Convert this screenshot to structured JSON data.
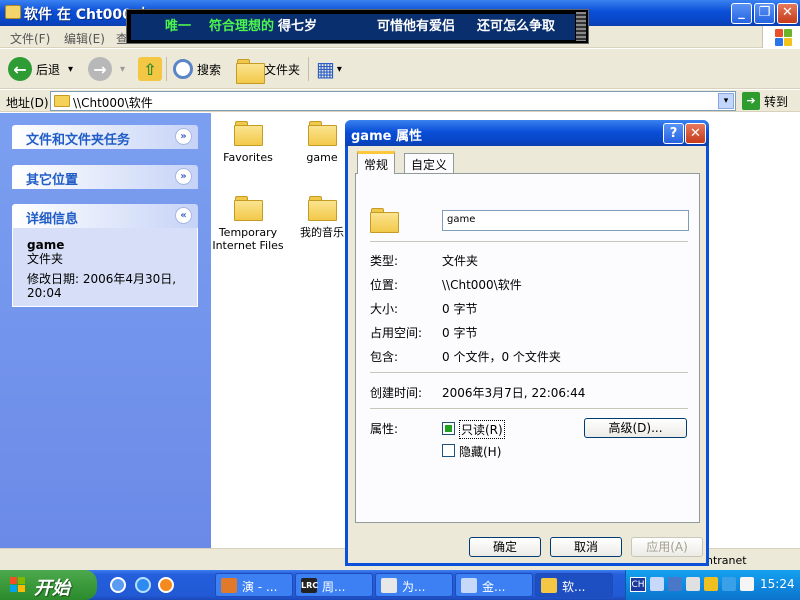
{
  "window": {
    "title": "软件 在 Cht000 上",
    "minimize": "_",
    "maximize": "❐",
    "close": "✕"
  },
  "lyrics": {
    "line1_a": "唯一",
    "line1_b": "符合理想的",
    "line1_c": "得七岁",
    "line2": "可惜他有爱侣",
    "line3": "还可怎么争取"
  },
  "menu": [
    "文件(F)",
    "编辑(E)",
    "查"
  ],
  "toolbar": {
    "back_label": "后退",
    "back_glyph": "←",
    "forward_glyph": "→",
    "dropdown_glyph": "▾",
    "up_glyph": "⇧",
    "search_label": "搜索",
    "folders_label": "文件夹",
    "views_glyph": "▦"
  },
  "address": {
    "label": "地址(D)",
    "value": "\\\\Cht000\\软件",
    "dropdown_glyph": "▾",
    "go_label": "转到",
    "go_glyph": "➔"
  },
  "taskpane": {
    "file_tasks_title": "文件和文件夹任务",
    "other_places_title": "其它位置",
    "details_title": "详细信息",
    "expand_glyph": "»",
    "collapse_glyph": "«",
    "details_name": "game",
    "details_type": "文件夹",
    "details_modified": "修改日期: 2006年4月30日,",
    "details_time": "20:04"
  },
  "files": [
    {
      "name": "Favorites"
    },
    {
      "name": "game"
    },
    {
      "name": "Temporary Internet Files"
    },
    {
      "name": "我的音乐"
    }
  ],
  "statusbar": {
    "zone": "ntranet"
  },
  "dialog": {
    "title": "game 属性",
    "help_glyph": "?",
    "close_glyph": "✕",
    "tabs": [
      "常规",
      "自定义"
    ],
    "name_value": "game",
    "type_label": "类型:",
    "type_value": "文件夹",
    "location_label": "位置:",
    "location_value": "\\\\Cht000\\软件",
    "size_label": "大小:",
    "size_value": "0 字节",
    "size_on_disk_label": "占用空间:",
    "size_on_disk_value": "0 字节",
    "contains_label": "包含:",
    "contains_value": "0 个文件，0 个文件夹",
    "created_label": "创建时间:",
    "created_value": "2006年3月7日, 22:06:44",
    "attributes_label": "属性:",
    "readonly_label": "只读(R)",
    "readonly_checked": true,
    "hidden_label": "隐藏(H)",
    "hidden_checked": false,
    "advanced_label": "高级(D)...",
    "ok_label": "确定",
    "cancel_label": "取消",
    "apply_label": "应用(A)"
  },
  "taskbar": {
    "start_label": "开始",
    "tasks": [
      {
        "label": "演 - ...",
        "icon": "music-icon",
        "badge": ""
      },
      {
        "label": "周...",
        "icon": "lrc-icon",
        "badge": "LRC"
      },
      {
        "label": "为...",
        "icon": "document-icon",
        "badge": ""
      },
      {
        "label": "金...",
        "icon": "window-icon",
        "badge": ""
      },
      {
        "label": "软...",
        "icon": "folder-icon",
        "badge": ""
      }
    ],
    "ime": "CH",
    "clock": "15:24"
  },
  "colors": {
    "title_blue": "#0a4fd8",
    "taskpane_blue": "#6b8ae8",
    "start_green": "#3a9a3a",
    "lyric_highlight": "#4cf54c"
  }
}
